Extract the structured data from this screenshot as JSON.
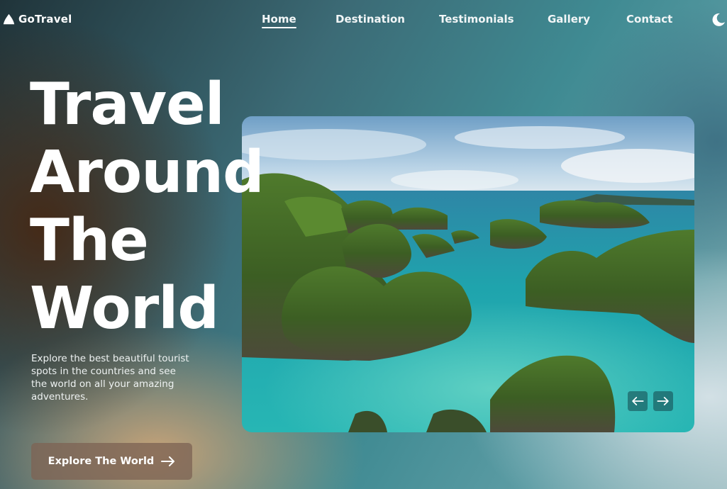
{
  "brand": {
    "name": "GoTravel"
  },
  "nav": {
    "items": [
      {
        "label": "Home",
        "active": true
      },
      {
        "label": "Destination"
      },
      {
        "label": "Testimonials"
      },
      {
        "label": "Gallery"
      },
      {
        "label": "Contact"
      }
    ],
    "theme_icon": "moon-icon"
  },
  "hero": {
    "title_lines": [
      "Travel",
      "Around",
      "The",
      "World"
    ],
    "description": "Explore the best beautiful tourist spots in the countries and see the world on all your amazing adventures.",
    "cta_label": "Explore The World",
    "cta_icon": "arrow-right-icon"
  },
  "carousel": {
    "image": "tropical-islands-lagoon-photo",
    "prev_icon": "arrow-left-icon",
    "next_icon": "arrow-right-icon"
  }
}
